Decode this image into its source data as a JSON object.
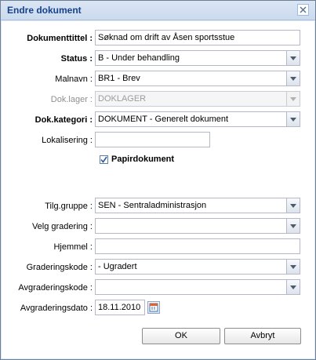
{
  "window": {
    "title": "Endre dokument"
  },
  "form": {
    "dokumenttittel": {
      "label": "Dokumenttittel :",
      "value": "Søknad om drift av Åsen sportsstue"
    },
    "status": {
      "label": "Status :",
      "value": "B - Under behandling"
    },
    "malnavn": {
      "label": "Malnavn :",
      "value": "BR1 - Brev"
    },
    "doklager": {
      "label": "Dok.lager :",
      "value": "DOKLAGER"
    },
    "dokkategori": {
      "label": "Dok.kategori :",
      "value": "DOKUMENT - Generelt dokument"
    },
    "lokalisering": {
      "label": "Lokalisering :",
      "value": ""
    },
    "papirdokument": {
      "label": "Papirdokument",
      "checked": true
    },
    "tilggruppe": {
      "label": "Tilg.gruppe :",
      "value": "SEN - Sentraladministrasjon"
    },
    "velggradering": {
      "label": "Velg gradering :",
      "value": ""
    },
    "hjemmel": {
      "label": "Hjemmel :",
      "value": ""
    },
    "graderingskode": {
      "label": "Graderingskode :",
      "value": "- Ugradert"
    },
    "avgraderingskode": {
      "label": "Avgraderingskode :",
      "value": ""
    },
    "avgraderingsdato": {
      "label": "Avgraderingsdato :",
      "value": "18.11.2010"
    }
  },
  "buttons": {
    "ok": "OK",
    "cancel": "Avbryt"
  },
  "icons": {
    "close": "close-icon",
    "combo": "chevron-down-icon",
    "checkbox": "checkmark-icon",
    "date": "calendar-icon"
  },
  "colors": {
    "title_text": "#15428b",
    "title_bg": "#cbdaee",
    "checkmark": "#2b5a9e"
  }
}
